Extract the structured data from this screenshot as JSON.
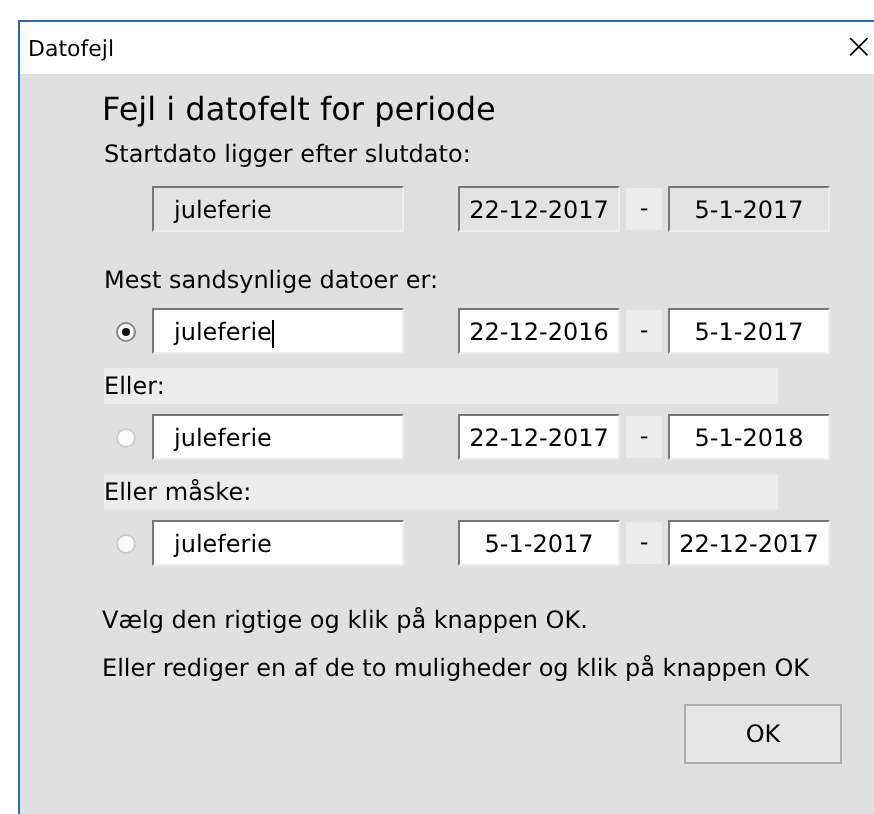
{
  "window": {
    "title": "Datofejl",
    "close": "×"
  },
  "heading": "Fejl i datofelt for periode",
  "original": {
    "label": "Startdato ligger efter slutdato:",
    "name": "juleferie",
    "start": "22-12-2017",
    "separator": "-",
    "end": "5-1-2017",
    "disabled": true
  },
  "options": [
    {
      "label": "Mest sandsynlige datoer er:",
      "shaded": false,
      "selected": true,
      "name": "juleferie",
      "start": "22-12-2016",
      "separator": "-",
      "end": "5-1-2017"
    },
    {
      "label": "Eller:",
      "shaded": true,
      "selected": false,
      "name": "juleferie",
      "start": "22-12-2017",
      "separator": "-",
      "end": "5-1-2018"
    },
    {
      "label": "Eller måske:",
      "shaded": true,
      "selected": false,
      "name": "juleferie",
      "start": "5-1-2017",
      "separator": "-",
      "end": "22-12-2017"
    }
  ],
  "instructions": [
    "Vælg den rigtige og klik på knappen OK.",
    "Eller rediger en af de to muligheder og klik på knappen OK"
  ],
  "buttons": [
    "OK"
  ]
}
